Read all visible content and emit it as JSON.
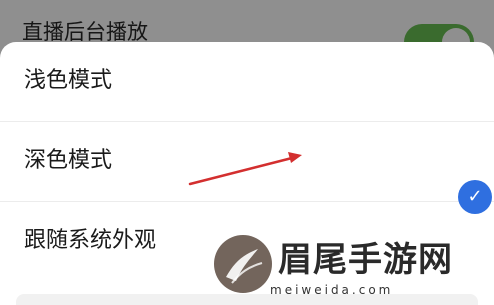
{
  "background_setting": {
    "label": "直播后台播放",
    "toggle_on": true
  },
  "sheet": {
    "options": [
      {
        "label": "浅色模式",
        "selected": false
      },
      {
        "label": "深色模式",
        "selected": false
      },
      {
        "label": "跟随系统外观",
        "selected": true
      }
    ],
    "check_icon": "✓"
  },
  "annotation": {
    "arrow_color": "#d32f2f"
  },
  "watermark": {
    "title": "眉尾手游网",
    "url": "meiweida.com",
    "color": "#2a2a2a"
  },
  "colors": {
    "accent": "#2f6fe0",
    "toggle": "#3a6b2e",
    "overlay": "#8f8f8f"
  }
}
